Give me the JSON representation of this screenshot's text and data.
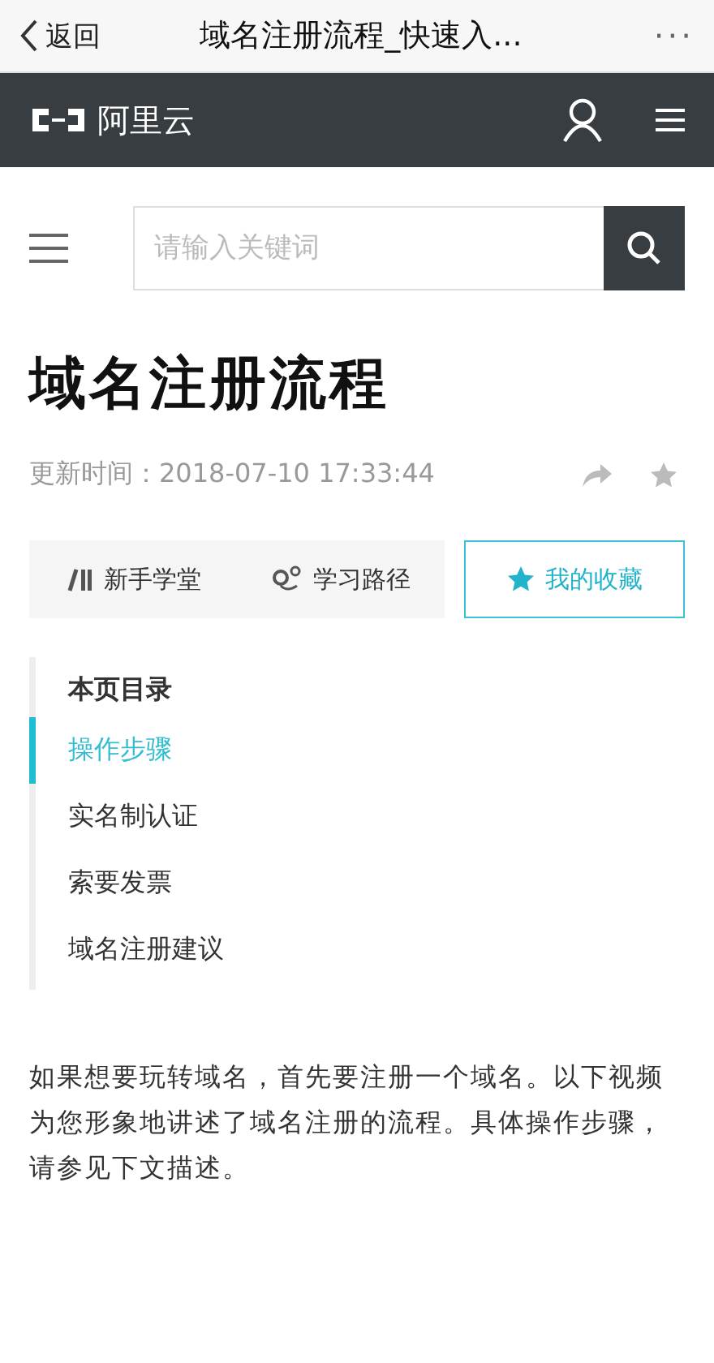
{
  "top_bar": {
    "back": "返回",
    "title": "域名注册流程_快速入...",
    "more": "···"
  },
  "nav": {
    "brand": "阿里云"
  },
  "search": {
    "placeholder": "请输入关键词"
  },
  "article": {
    "title": "域名注册流程",
    "updated": "更新时间：2018-07-10 17:33:44"
  },
  "quick_links": [
    {
      "kind": "learn",
      "label": "新手学堂",
      "selected": false
    },
    {
      "kind": "path",
      "label": "学习路径",
      "selected": false
    },
    {
      "kind": "favorite",
      "label": "我的收藏",
      "selected": true
    }
  ],
  "toc": {
    "heading": "本页目录",
    "items": [
      {
        "label": "操作步骤",
        "selected": true
      },
      {
        "label": "实名制认证",
        "selected": false
      },
      {
        "label": "索要发票",
        "selected": false
      },
      {
        "label": "域名注册建议",
        "selected": false
      }
    ]
  },
  "paragraph": "如果想要玩转域名，首先要注册一个域名。以下视频为您形象地讲述了域名注册的流程。具体操作步骤，请参见下文描述。"
}
